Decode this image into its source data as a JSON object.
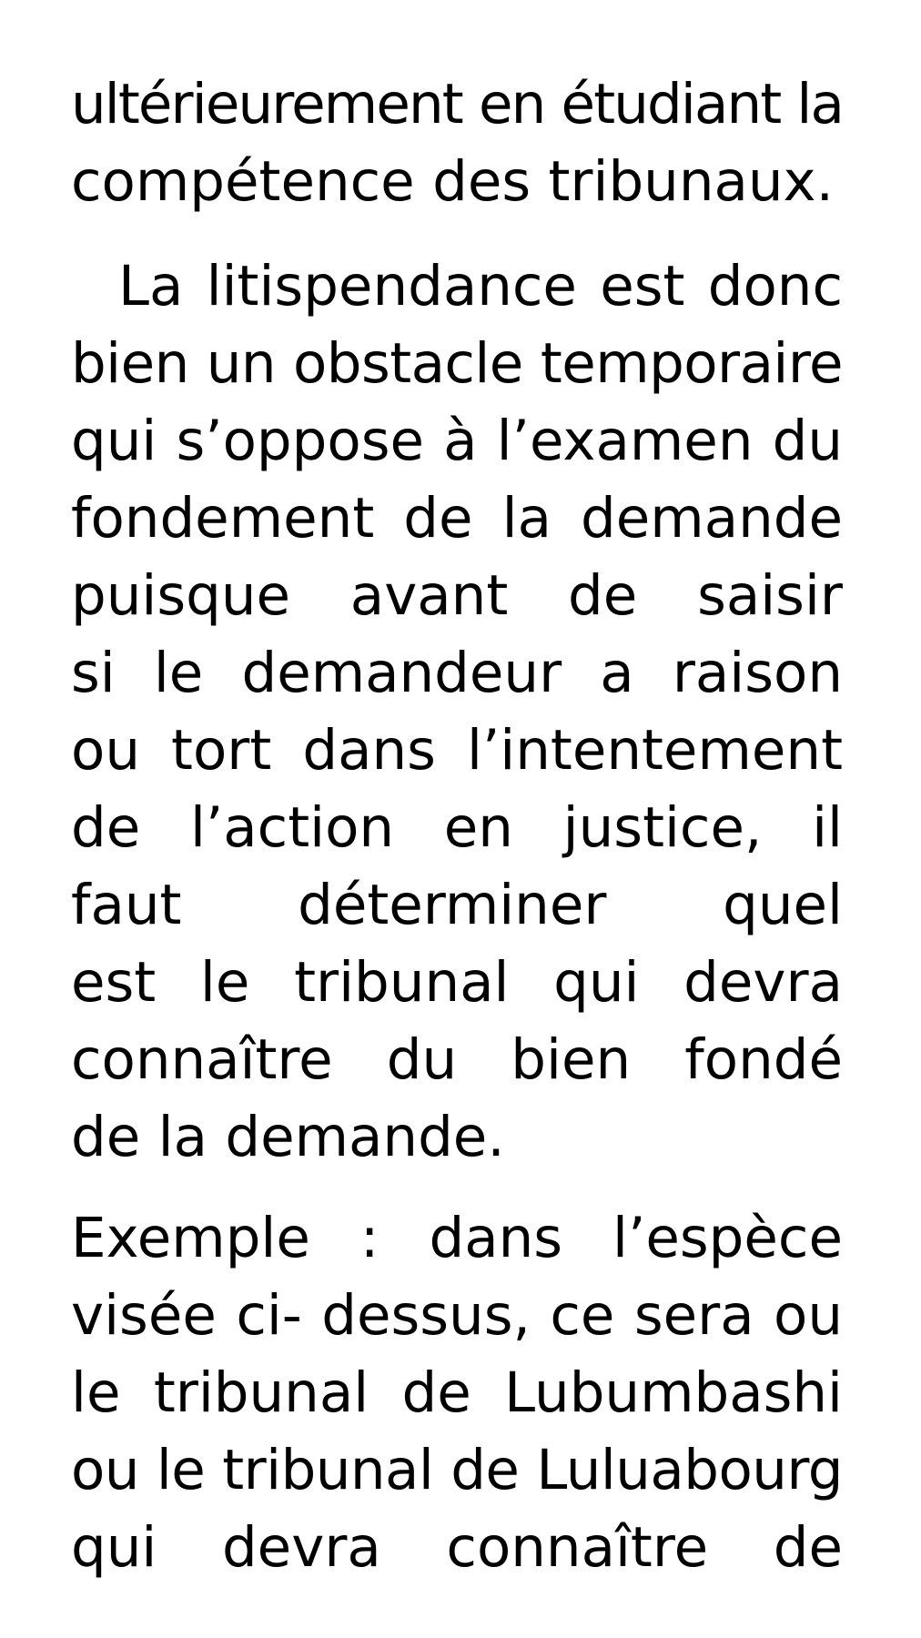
{
  "document": {
    "paragraphs": [
      {
        "lines": [
          "ultérieurement en étudiant la",
          "compétence des tribunaux."
        ]
      },
      {
        "lines": [
          "La litispendance est donc",
          "bien un obstacle temporaire",
          "qui s’oppose à l’examen du",
          "fondement de la demande",
          "puisque avant de saisir",
          "si le demandeur a raison",
          "ou tort dans l’intentement",
          "de l’action en justice, il",
          "faut déterminer quel",
          "est le tribunal qui devra",
          "connaître du bien fondé",
          "de la demande."
        ]
      },
      {
        "lines": [
          "Exemple : dans l’espèce",
          "visée ci- dessus, ce sera ou",
          "le tribunal de Lubumbashi",
          "ou le tribunal de Luluabourg",
          "qui devra connaître de"
        ]
      }
    ]
  }
}
